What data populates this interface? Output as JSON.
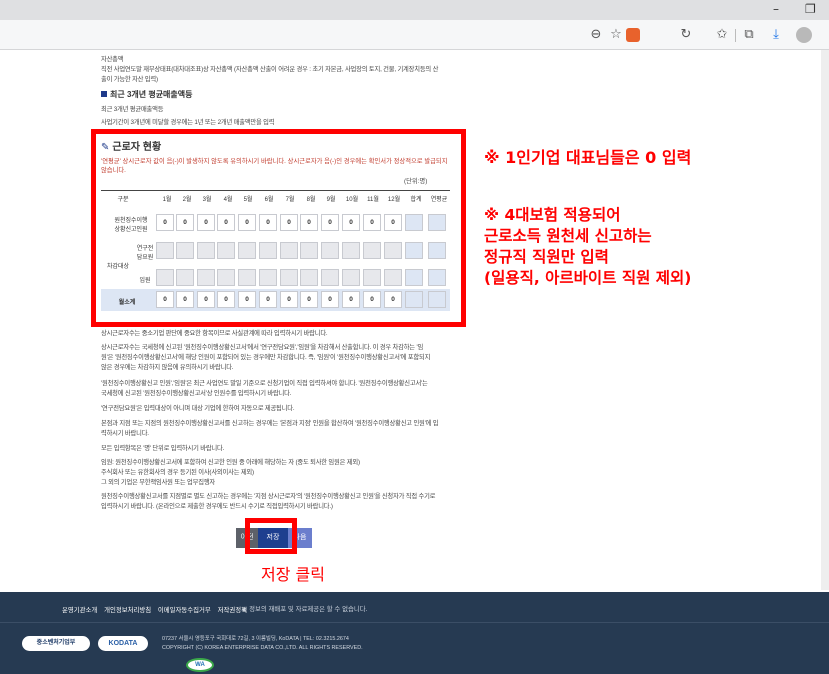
{
  "browser": {
    "minimize": "–",
    "restore": "❐",
    "icons": [
      "zoom-out-icon",
      "favorite-add-icon",
      "extension-icon",
      "refresh-icon",
      "favorites-icon",
      "collections-icon",
      "download-icon",
      "profile-icon"
    ]
  },
  "page": {
    "asset_heading": "자산총액",
    "asset_text1": "직전 사업연도말 재무상태표(대차대조표)상 자산총액 (자산총액 산출이 어려운 경우 : 초기 자본금, 사업장의 토지, 건물, 기계장치등의 산",
    "asset_text2": "출이 가능한 자산 입력)",
    "sales_title": "최근 3개년 평균매출액등",
    "sales_text1": "최근 3개년 평균매출액등",
    "sales_text2": "사업기간이 3개년에 미달할 경우에는 1년 또는 2개년 매출액만을 입력",
    "employee_title": "근로자 현황",
    "red_note1": "'연평균' 상시근로자 값이 음(-)이 발생하지 않도록 유의하시기 바랍니다. 상시근로자가 음(-)인 경우에는 확인서가 정상적으로 발급되지",
    "red_note2": "않습니다.",
    "unit": "(단위:명)"
  },
  "table": {
    "headers": [
      "구분",
      "1월",
      "2월",
      "3월",
      "4월",
      "5월",
      "6월",
      "7월",
      "8월",
      "9월",
      "10월",
      "11월",
      "12월",
      "합계",
      "연평균"
    ],
    "row1_label1": "원천징수이행",
    "row1_label2": "상황신고인원",
    "row1_values": [
      "0",
      "0",
      "0",
      "0",
      "0",
      "0",
      "0",
      "0",
      "0",
      "0",
      "0",
      "0"
    ],
    "group_label": "차감대상",
    "row2_label1": "연구전",
    "row2_label2": "담요원",
    "row3_label": "임원",
    "total_label": "월소계",
    "total_values": [
      "0",
      "0",
      "0",
      "0",
      "0",
      "0",
      "0",
      "0",
      "0",
      "0",
      "0",
      "0"
    ]
  },
  "notes": [
    "상시근로자수는 중소기업 판단에 중요한 항목이므로 사실관계에 따라 입력하시기 바랍니다.",
    "상시근로자수는 국세청에 신고된 '원천징수이행상황신고서'에서 '연구전담요원','임원'을 차감해서 산출합니다. 이 경우 차감하는 '임",
    "원'은 '원천징수이행상황신고서'에 해당 인원이 포함되어 있는 경우에만 차감합니다. 즉, '임원'이 '원천징수이행상황신고서'에 포함되지",
    "않은 경우에는 차감하지 않음에 유의하시기 바랍니다.",
    "'원천징수이행상황신고 인원','임원'은 최근 사업연도 말일 기준으로 신청기업이 직접 입력하셔야 합니다. '원천징수이행상황신고서'는",
    "국세청에 신고된 '원천징수이행상황신고서'상 인원수를 입력하시기 바랍니다.",
    "'연구전담요원'은 입력대상이 아니며 대상 기업에 한하여 자동으로 제공됩니다.",
    "본점과 지점 또는 지점의 원천징수이행상황신고서를 신고하는 경우에는 '본점과 지점' 인원을 합산하여 '원천징수이행상황신고 인원'에 입",
    "력하시기 바랍니다.",
    "모든 입력항목은 '명' 단위로 입력하시기 바랍니다.",
    "임원: 원천징수이행상황신고서에 포함하여 신고한 인원 중 아래에 해당하는 자 (중도 퇴사한 임원은 제외)",
    "주식회사 또는 유한회사의 경우 등기된 이사(사외이사는 제외)",
    "그 외의 기업은 무한책임사원 또는 업무집행자",
    "원천징수이행상황신고서를 지점별로 별도 신고하는 경우에는 '지점 상시근로자'의 '원천징수이행상황신고 인원'을 신청자가 직접 수기로",
    "입력하시기 바랍니다. (온라인으로 제출한 경우에도 반드시 수기로 직접입력하시기 바랍니다.)"
  ],
  "annotations": {
    "note1": "※ 1인기업 대표님들은 0 입력",
    "note2_line1": "※ 4대보험 적용되어",
    "note2_line2": "근로소득 원천세 신고하는",
    "note2_line3": "정규직 직원만 입력",
    "note2_line4": "(일용직, 아르바이트 직원 제외)",
    "save_click": "저장 클릭"
  },
  "buttons": {
    "prev": "이전",
    "save": "저장",
    "next": "다음"
  },
  "footer": {
    "links": [
      "운영기관소개",
      "개인정보처리방침",
      "이메일자동수집거부",
      "저작권정책"
    ],
    "warning": "▲ 정보의 재배포 및 자료제공은 할 수 없습니다.",
    "logo1": "중소벤처기업부",
    "logo2": "KODATA",
    "address": "07237 서울시 영등포구 국회대로 72길, 3 이룸빌딩, KoDATA | TEL: 02.3215.2674",
    "copyright": "COPYRIGHT (C) KOREA ENTERPRISE DATA CO.,LTD. ALL RIGHTS RESERVED.",
    "badge": "WA"
  }
}
